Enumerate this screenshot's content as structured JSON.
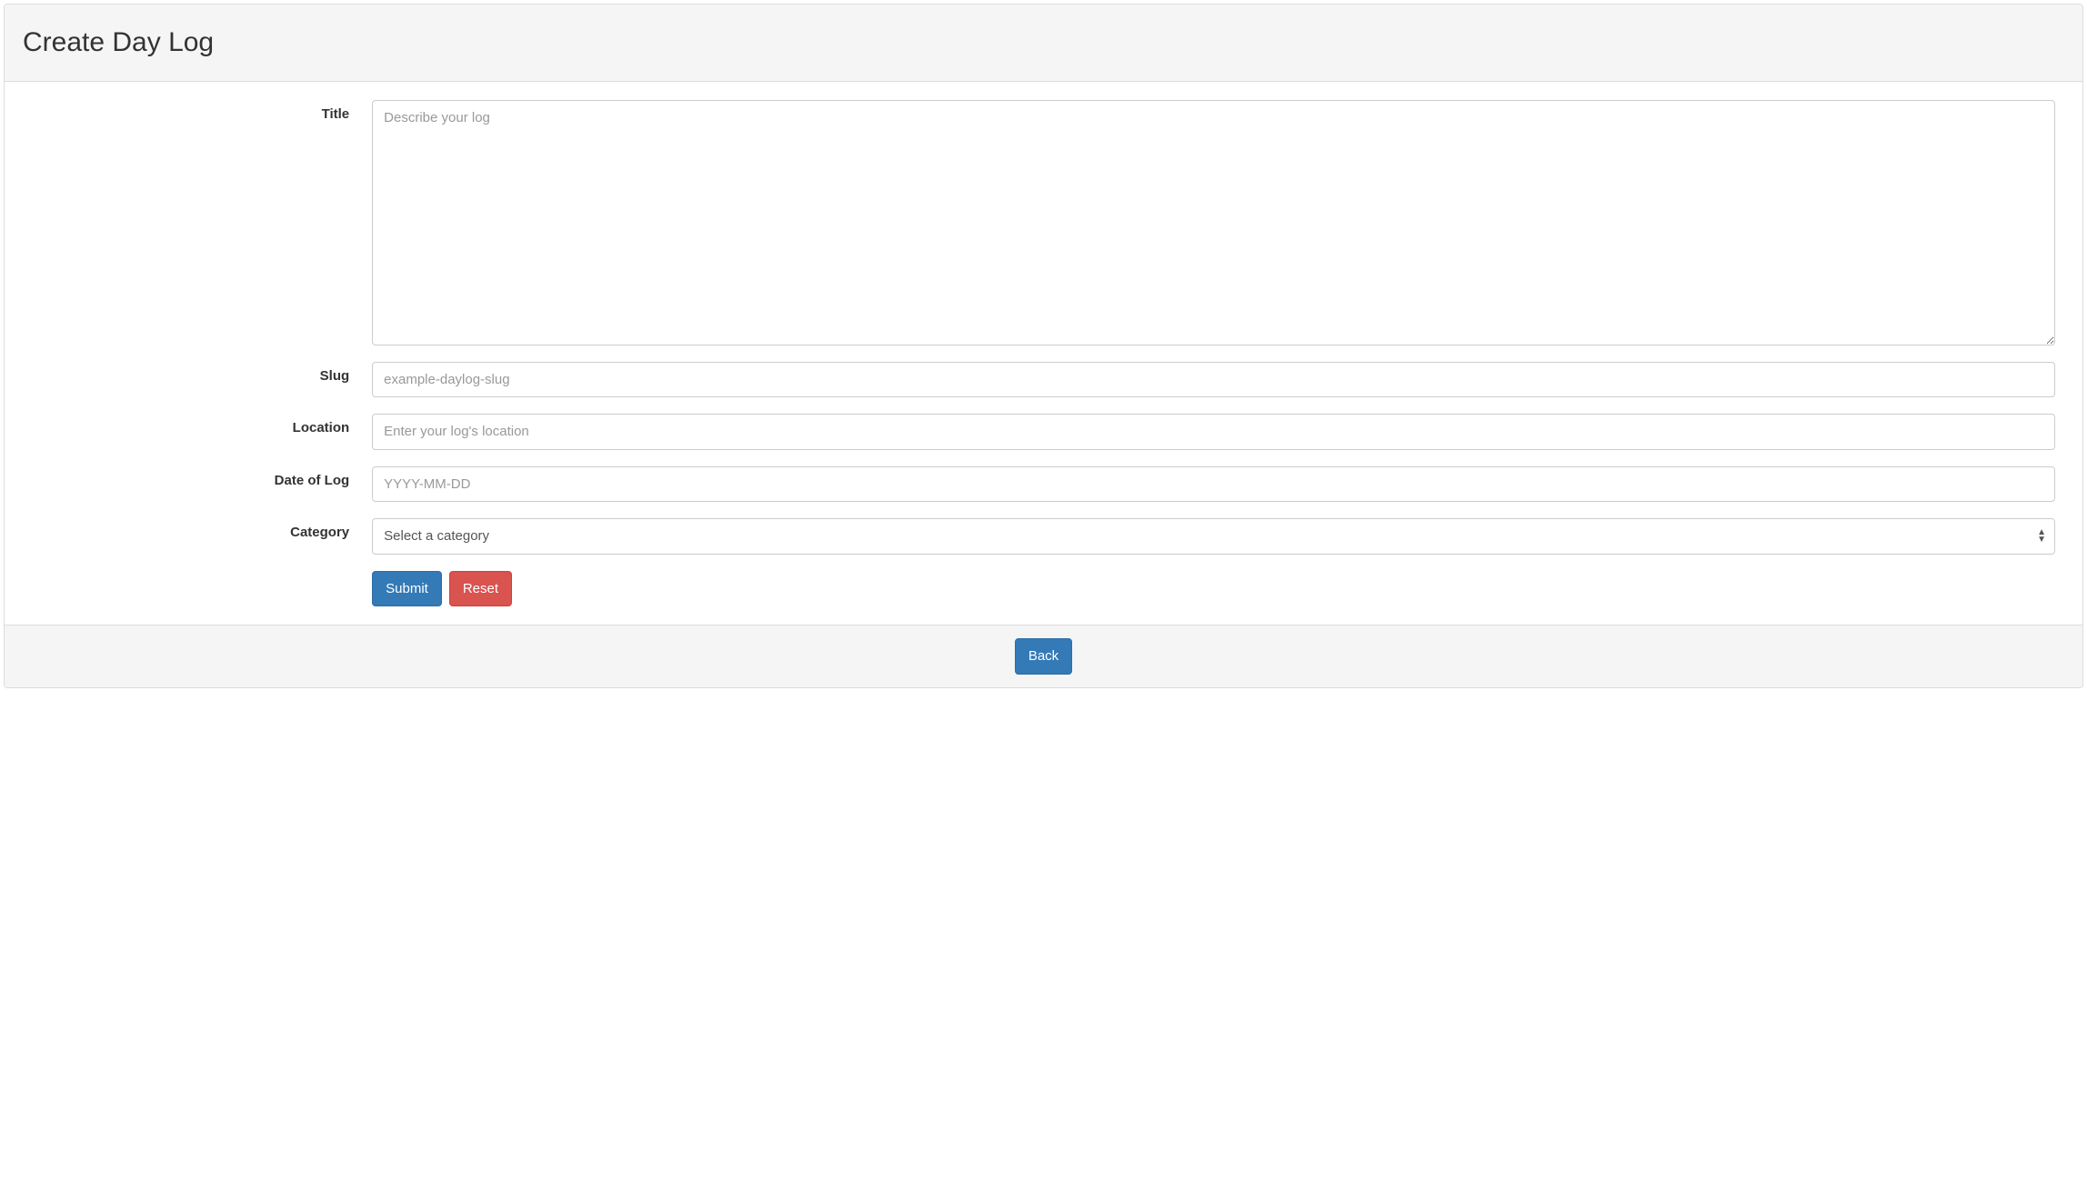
{
  "header": {
    "title": "Create Day Log"
  },
  "form": {
    "title": {
      "label": "Title",
      "placeholder": "Describe your log",
      "value": ""
    },
    "slug": {
      "label": "Slug",
      "placeholder": "example-daylog-slug",
      "value": ""
    },
    "location": {
      "label": "Location",
      "placeholder": "Enter your log's location",
      "value": ""
    },
    "date": {
      "label": "Date of Log",
      "placeholder": "YYYY-MM-DD",
      "value": ""
    },
    "category": {
      "label": "Category",
      "selected": "Select a category"
    },
    "actions": {
      "submit": "Submit",
      "reset": "Reset"
    }
  },
  "footer": {
    "back": "Back"
  }
}
